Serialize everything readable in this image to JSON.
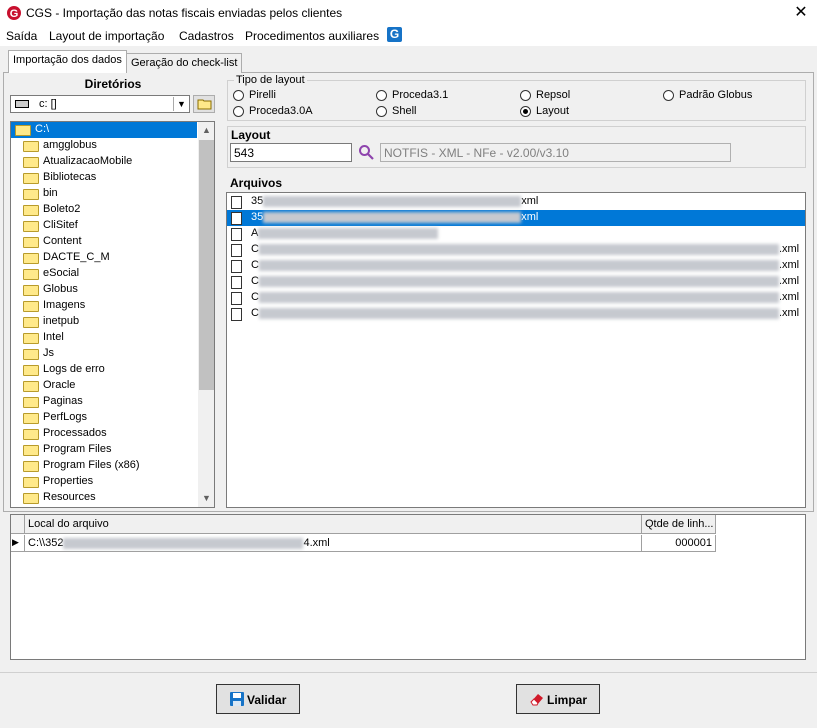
{
  "window": {
    "title": "CGS - Importação das notas fiscais enviadas pelos clientes",
    "close_glyph": "✕"
  },
  "menu": {
    "items": [
      "Saída",
      "Layout de importação",
      "Cadastros",
      "Procedimentos auxiliares"
    ],
    "logo_letter": "G"
  },
  "tabs": [
    "Importação dos dados",
    "Geração do check-list"
  ],
  "directories": {
    "header": "Diretórios",
    "drive": "c: []",
    "current": "C:\\",
    "items": [
      "amgglobus",
      "AtualizacaoMobile",
      "Bibliotecas",
      "bin",
      "Boleto2",
      "CliSitef",
      "Content",
      "DACTE_C_M",
      "eSocial",
      "Globus",
      "Imagens",
      "inetpub",
      "Intel",
      "Js",
      "Logs de erro",
      "Oracle",
      "Paginas",
      "PerfLogs",
      "Processados",
      "Program Files",
      "Program Files (x86)",
      "Properties",
      "Resources"
    ]
  },
  "layout_type": {
    "title": "Tipo de layout",
    "options": [
      "Pirelli",
      "Proceda3.1",
      "Repsol",
      "Padrão Globus",
      "Proceda3.0A",
      "Shell",
      "Layout"
    ],
    "selected": "Layout"
  },
  "layout": {
    "label": "Layout",
    "code": "543",
    "description": "NOTFIS - XML - NFe - v2.00/v3.10",
    "search_icon": "magnifier-icon"
  },
  "arquivos": {
    "label": "Arquivos",
    "files": [
      {
        "prefix": "35",
        "suffix": "xml"
      },
      {
        "prefix": "35",
        "suffix": "xml",
        "selected": true
      },
      {
        "prefix": "A",
        "suffix": ""
      },
      {
        "prefix": "C",
        "suffix": ".xml"
      },
      {
        "prefix": "C",
        "suffix": ".xml"
      },
      {
        "prefix": "C",
        "suffix": ".xml"
      },
      {
        "prefix": "C",
        "suffix": ".xml"
      },
      {
        "prefix": "C",
        "suffix": ".xml"
      }
    ]
  },
  "grid": {
    "headers": [
      "Local do arquivo",
      "Qtde de linh..."
    ],
    "rows": [
      {
        "path_prefix": "C:\\\\352",
        "path_suffix": "4.xml",
        "count": "000001",
        "indicator": "▶"
      }
    ]
  },
  "buttons": {
    "validar": "Validar",
    "limpar": "Limpar"
  },
  "colors": {
    "selection": "#0078d7",
    "folder": "#ffe98a",
    "logo_red": "#c8102e",
    "logo_blue": "#1673c7"
  }
}
